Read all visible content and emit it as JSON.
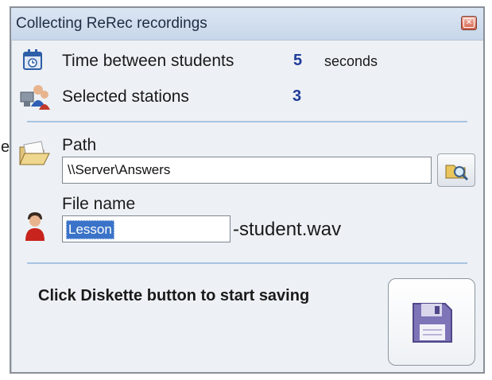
{
  "page": {
    "stray_text": "e"
  },
  "window": {
    "title": "Collecting ReRec recordings",
    "close_icon": "close-icon"
  },
  "settings": {
    "time_label": "Time between students",
    "time_value": "5",
    "time_unit": "seconds",
    "stations_label": "Selected stations",
    "stations_value": "3"
  },
  "path": {
    "label": "Path",
    "value": "\\\\Server\\Answers",
    "browse_icon": "folder-search-icon"
  },
  "file": {
    "label": "File name",
    "value": "Lesson",
    "suffix": "-student.wav"
  },
  "footer": {
    "hint": "Click Diskette button to start saving",
    "save_icon": "diskette-icon"
  },
  "colors": {
    "accent_value": "#1f3c99",
    "divider": "#a8c3e0",
    "selection": "#3a73c8",
    "diskette": "#7e74b8"
  }
}
